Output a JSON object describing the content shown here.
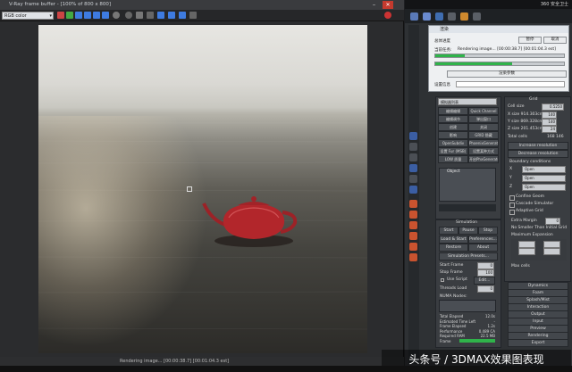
{
  "vfb": {
    "title": "V-Ray frame buffer - [100% of 800 x 800]",
    "channel": "RGB color",
    "status": "Rendering image... [00:00:38.7] [00:01:04.3 est]"
  },
  "max": {
    "title": "360 安全卫士"
  },
  "dialog": {
    "title": "渲染",
    "stop": "暂停",
    "cancel": "取消",
    "overall_label": "总体进度",
    "current_label": "当前任务:",
    "current_task": "Rendering image... [00:00:38.7] [00:01:04.3 est]",
    "overall_progress": 0.23,
    "current_progress": 0.6,
    "params_label": "渲染参数",
    "extra_label": "设置信息"
  },
  "left_panel": {
    "dropdown": "模拟器列表",
    "rows": [
      [
        "编辑编辑",
        "Quick Channel"
      ],
      [
        "编辑调节",
        "弹出窗口"
      ],
      [
        "创建",
        "关闭"
      ],
      [
        "影响",
        "GRID 隐藏"
      ],
      [
        "OpenSubdiv",
        "PhoenixGenerator"
      ],
      [
        "设置 Fur (MSB)",
        "设置某种方式"
      ],
      [
        "LOW 质量",
        "开启PhxGenerator"
      ]
    ],
    "object_header": "Object",
    "simulation": {
      "header": "Simulation",
      "start": "Start",
      "pause": "Pause",
      "stop": "Stop",
      "load_start": "Load & Start",
      "preferences": "Preferences...",
      "restore": "Restore",
      "about": "About",
      "presets": "Simulation Presets...",
      "start_frame_label": "Start Frame",
      "start_frame_value": "0",
      "stop_frame_label": "Stop Frame",
      "stop_frame_value": "100",
      "use_script_label": "Use Script",
      "use_script_button": "Edit...",
      "threads_label": "Threads Load",
      "threads_value": "0",
      "notes_label": "NUMA Nodes:",
      "stats": [
        [
          "Total Elapsed",
          "12.0s"
        ],
        [
          "Estimated Time Left",
          "-"
        ],
        [
          "Frame Elapsed",
          "1.2s"
        ],
        [
          "Performance",
          "0.489 CA"
        ],
        [
          "Required RAM",
          "22.5 MB"
        ],
        [
          "Frame",
          ""
        ]
      ]
    }
  },
  "grid": {
    "header": "Grid",
    "cell_size_label": "Cell size",
    "cell_size_value": "0.5250",
    "x_label": "X size 914.303cm",
    "x_value": "140",
    "y_label": "Y size 869.328cm",
    "y_value": "140",
    "z_label": "Z size 201.453cm",
    "z_value": "24",
    "total_label": "Total cells",
    "total_value": "168 146",
    "increase": "Increase resolution",
    "decrease": "Decrease resolution",
    "boundary_header": "Boundary conditions",
    "axes": [
      {
        "axis": "X",
        "value": "Open"
      },
      {
        "axis": "Y",
        "value": "Open"
      },
      {
        "axis": "Z",
        "value": "Open"
      }
    ],
    "options": [
      "Confine Geom",
      "Cascade Simulator",
      "Adaptive Grid"
    ],
    "extra_margin_label": "Extra Margin",
    "extra_margin_value": "0",
    "no_smaller_label": "No Smaller Than Initial Grid",
    "max_expansion_label": "Maximum Expansion",
    "max_cells_label": "Max cells",
    "sections": [
      "Dynamics",
      "Foam",
      "Splash/Mist",
      "Interaction",
      "Output",
      "Input",
      "Preview",
      "Rendering",
      "Export"
    ]
  },
  "watermark": "头条号 / 3DMAX效果图表现",
  "colors": {
    "progress_green": "#2fb34a",
    "teapot": "#b2262b"
  }
}
